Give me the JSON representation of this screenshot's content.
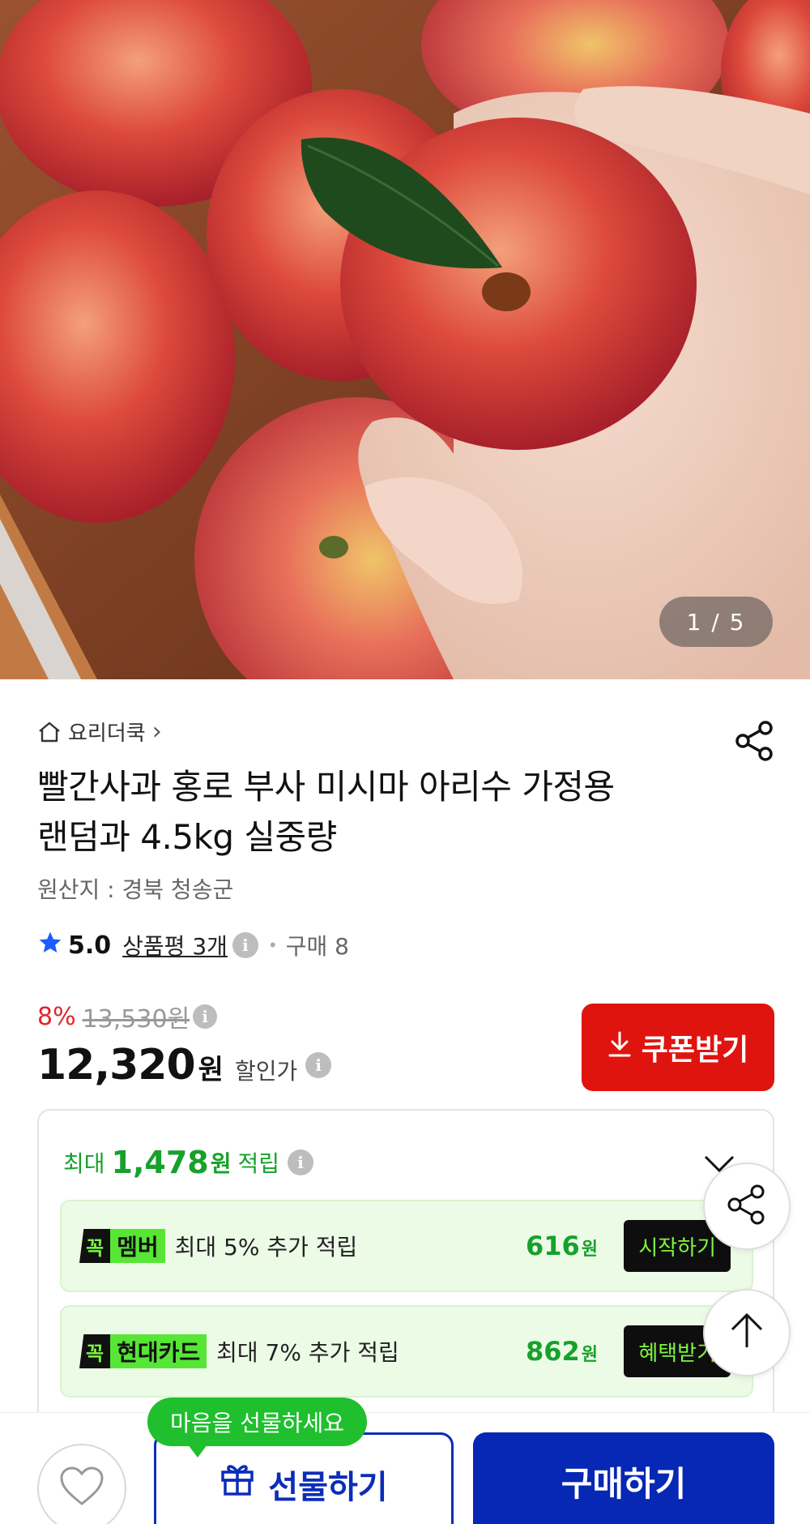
{
  "gallery": {
    "image_alt": "apples in wooden tray, hand holding apple with leaf",
    "counter": "1 / 5"
  },
  "store": {
    "name": "요리더쿡",
    "chevron": "›"
  },
  "product": {
    "title": "빨간사과 홍로 부사 미시마 아리수 가정용 랜덤과 4.5kg 실중량",
    "origin": "원산지 : 경북 청송군"
  },
  "rating": {
    "score": "5.0",
    "reviews": "상품평 3개",
    "separator": "•",
    "purchase": "구매 8"
  },
  "price": {
    "discount_rate": "8%",
    "original": "13,530원",
    "sale": "12,320",
    "won": "원",
    "label": "할인가"
  },
  "coupon": {
    "label": "쿠폰받기"
  },
  "reward": {
    "prefix": "최대",
    "amount": "1,478",
    "won": "원",
    "suffix": "적립",
    "items": [
      {
        "kkok": "꼭",
        "badge": "멤버",
        "desc": "최대 5% 추가 적립",
        "amount": "616",
        "won": "원",
        "action": "시작하기"
      },
      {
        "kkok": "꼭",
        "badge": "현대카드",
        "desc": "최대 7% 추가 적립",
        "amount": "862",
        "won": "원",
        "action": "혜택받기"
      }
    ]
  },
  "bottom": {
    "gift_bubble": "마음을 선물하세요",
    "gift": "선물하기",
    "buy": "구매하기"
  },
  "colors": {
    "accent_red": "#e0140f",
    "accent_blue": "#0727b5",
    "reward_green": "#17a12b",
    "star_blue": "#1a5cff"
  }
}
